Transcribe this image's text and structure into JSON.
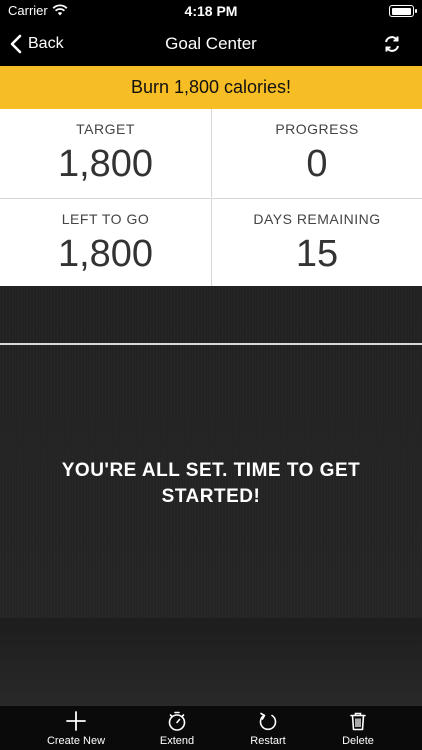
{
  "status_bar": {
    "carrier": "Carrier",
    "time": "4:18 PM",
    "icons": [
      "wifi-icon",
      "battery-icon"
    ]
  },
  "nav": {
    "back_label": "Back",
    "title": "Goal Center",
    "right_icon": "refresh-icon"
  },
  "goal": {
    "banner": "Burn 1,800 calories!"
  },
  "stats": [
    {
      "label": "TARGET",
      "value": "1,800"
    },
    {
      "label": "PROGRESS",
      "value": "0"
    },
    {
      "label": "LEFT TO GO",
      "value": "1,800"
    },
    {
      "label": "DAYS REMAINING",
      "value": "15"
    }
  ],
  "message": "YOU'RE ALL SET. TIME TO GET STARTED!",
  "tab_bar": [
    {
      "label": "Create New",
      "icon": "plus-icon"
    },
    {
      "label": "Extend",
      "icon": "stopwatch-icon"
    },
    {
      "label": "Restart",
      "icon": "restart-icon"
    },
    {
      "label": "Delete",
      "icon": "trash-icon"
    }
  ],
  "colors": {
    "banner_bg": "#f6bd24",
    "nav_bg": "#000000",
    "stats_bg": "#ffffff",
    "dark_bg": "#242424"
  }
}
